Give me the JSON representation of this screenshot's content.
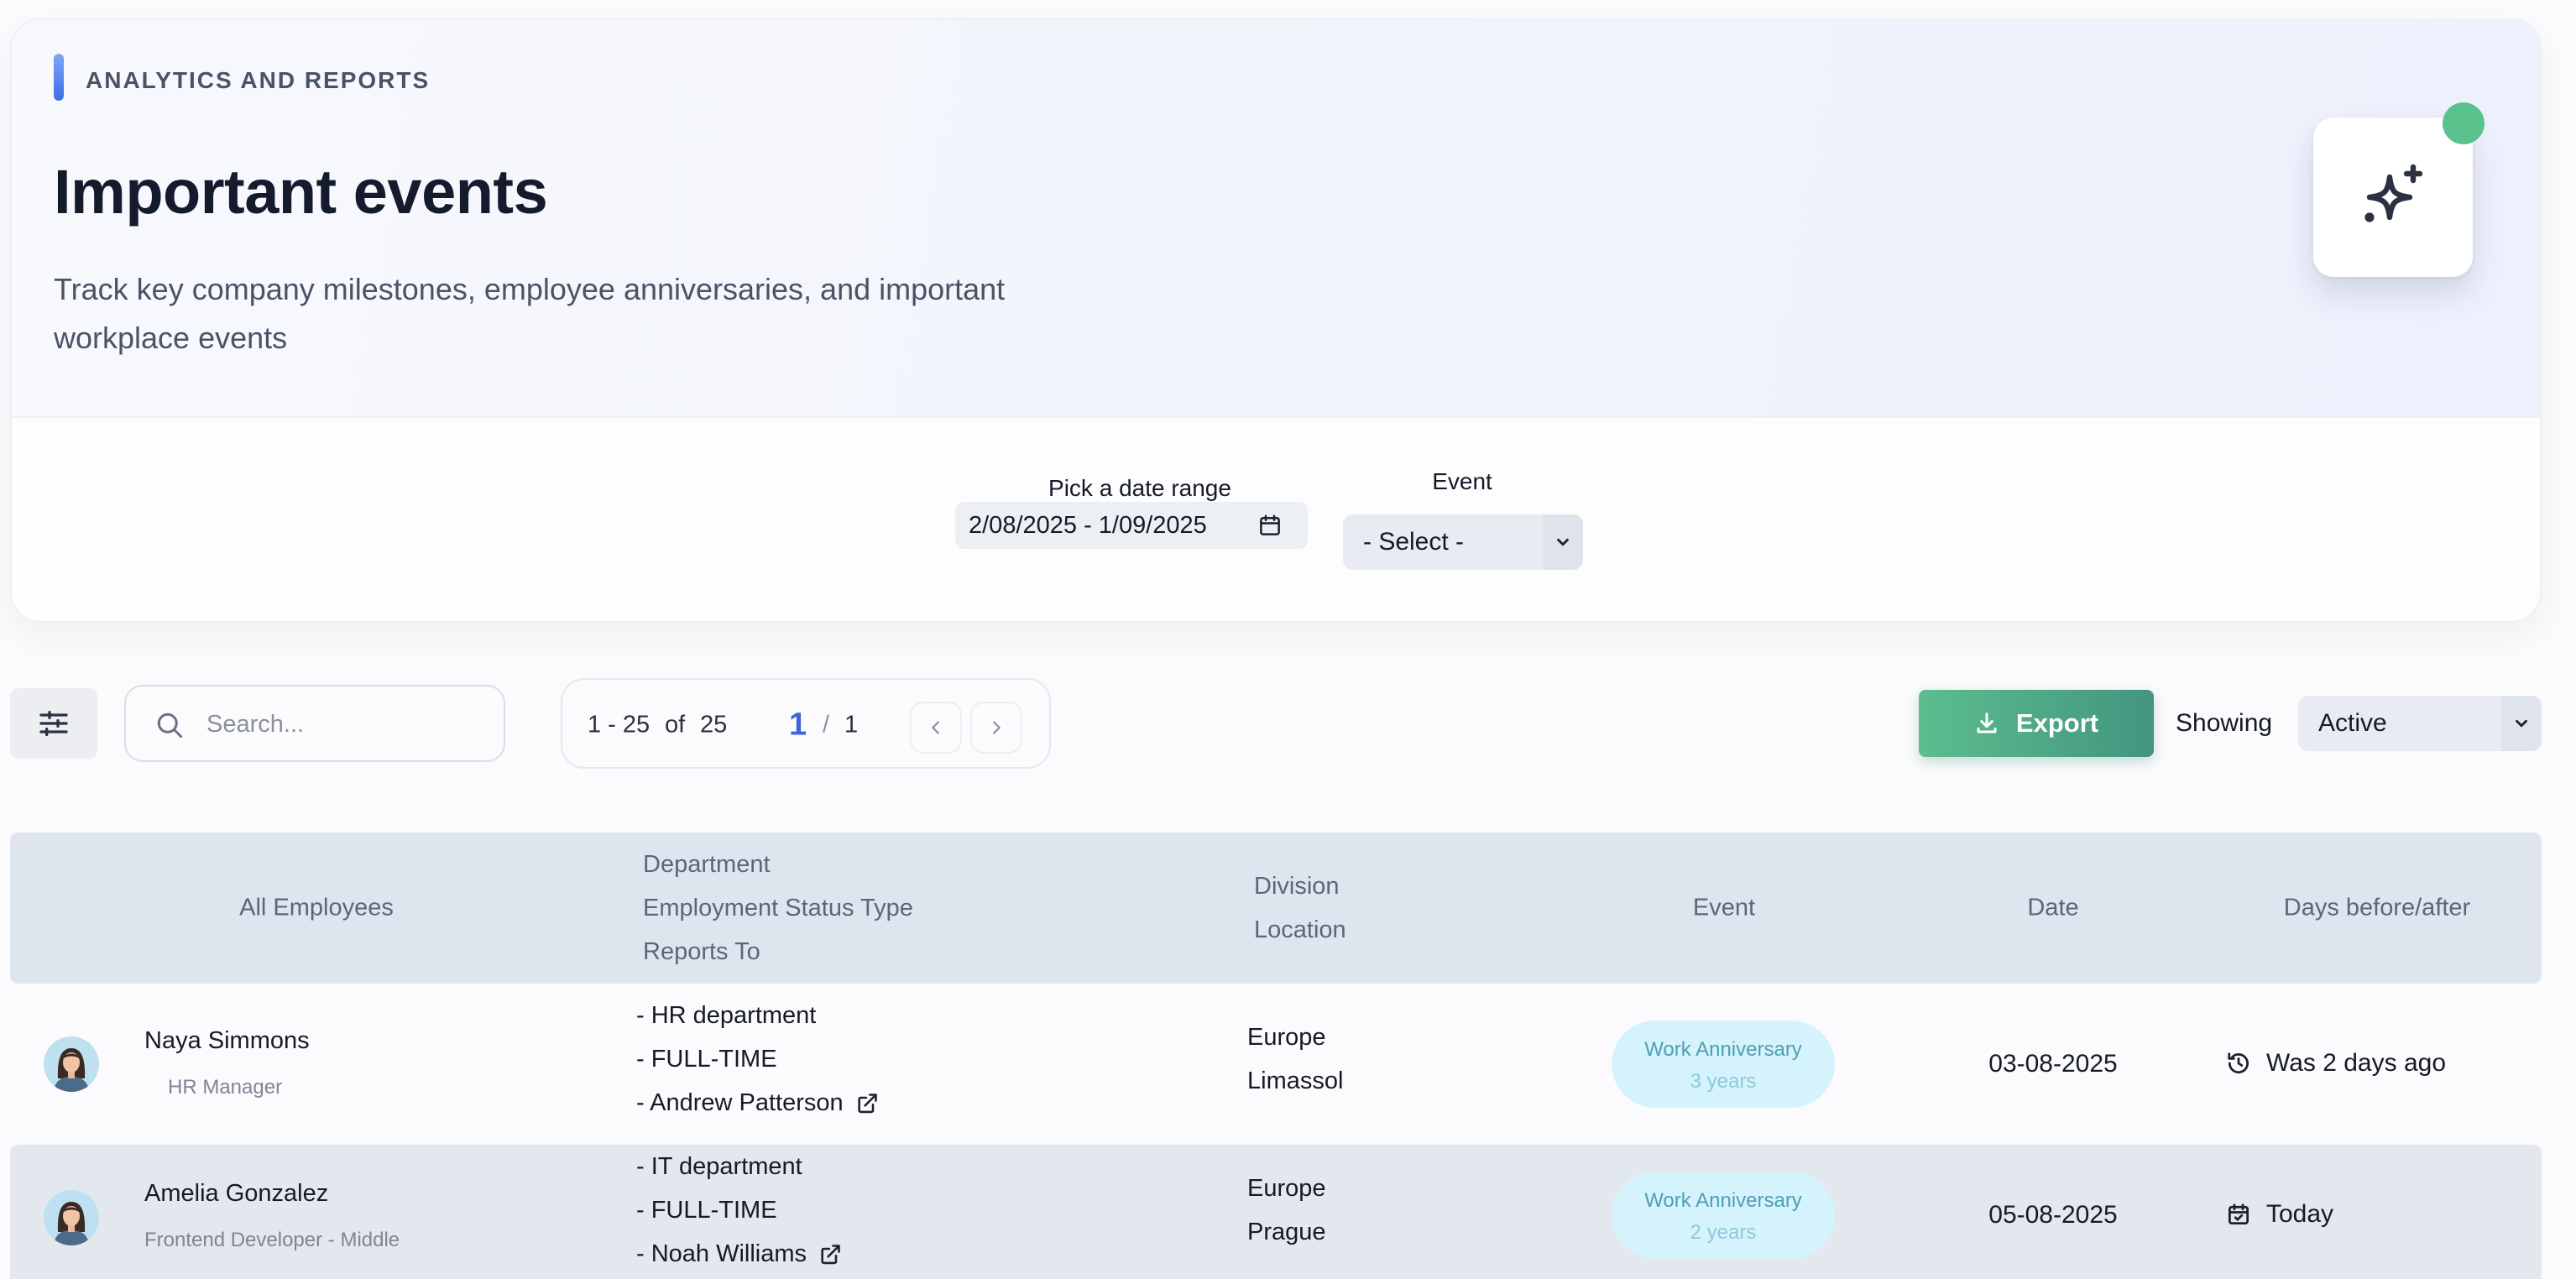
{
  "header": {
    "eyebrow": "ANALYTICS AND REPORTS",
    "title": "Important events",
    "subtitle": "Track key company milestones, employee anniversaries, and important workplace events"
  },
  "ai_icon": "sparkles-icon",
  "filters": {
    "date_label": "Pick a date range",
    "date_value": "2/08/2025 - 1/09/2025",
    "event_label": "Event",
    "event_value": "- Select -"
  },
  "toolbar": {
    "search_placeholder": "Search...",
    "range_text": "1 - 25",
    "of_text": "of",
    "total": "25",
    "current_page": "1",
    "page_sep": "/",
    "total_pages": "1",
    "export_label": "Export",
    "showing_label": "Showing",
    "showing_value": "Active"
  },
  "table": {
    "headers": {
      "employees": "All Employees",
      "department": "Department",
      "employment_status": "Employment Status Type",
      "reports_to": "Reports To",
      "division": "Division",
      "location": "Location",
      "event": "Event",
      "date": "Date",
      "days": "Days before/after"
    },
    "rows": [
      {
        "name": "Naya Simmons",
        "role": "HR Manager",
        "department": "- HR department",
        "status": "- FULL-TIME",
        "reports_to": "- Andrew Patterson",
        "division": "Europe",
        "location": "Limassol",
        "event_title": "Work Anniversary",
        "event_sub": "3 years",
        "date": "03-08-2025",
        "relative": "Was 2 days ago",
        "relative_icon": "history-icon"
      },
      {
        "name": "Amelia Gonzalez",
        "role": "Frontend Developer - Middle",
        "department": "- IT department",
        "status": "- FULL-TIME",
        "reports_to": "- Noah Williams",
        "division": "Europe",
        "location": "Prague",
        "event_title": "Work Anniversary",
        "event_sub": "2 years",
        "date": "05-08-2025",
        "relative": "Today",
        "relative_icon": "calendar-check-icon"
      }
    ]
  },
  "colors": {
    "accent_blue": "#3f63d8",
    "export_green": "#5cbd8e",
    "status_dot": "#5ac28c",
    "badge_bg": "#d5f3fc"
  }
}
